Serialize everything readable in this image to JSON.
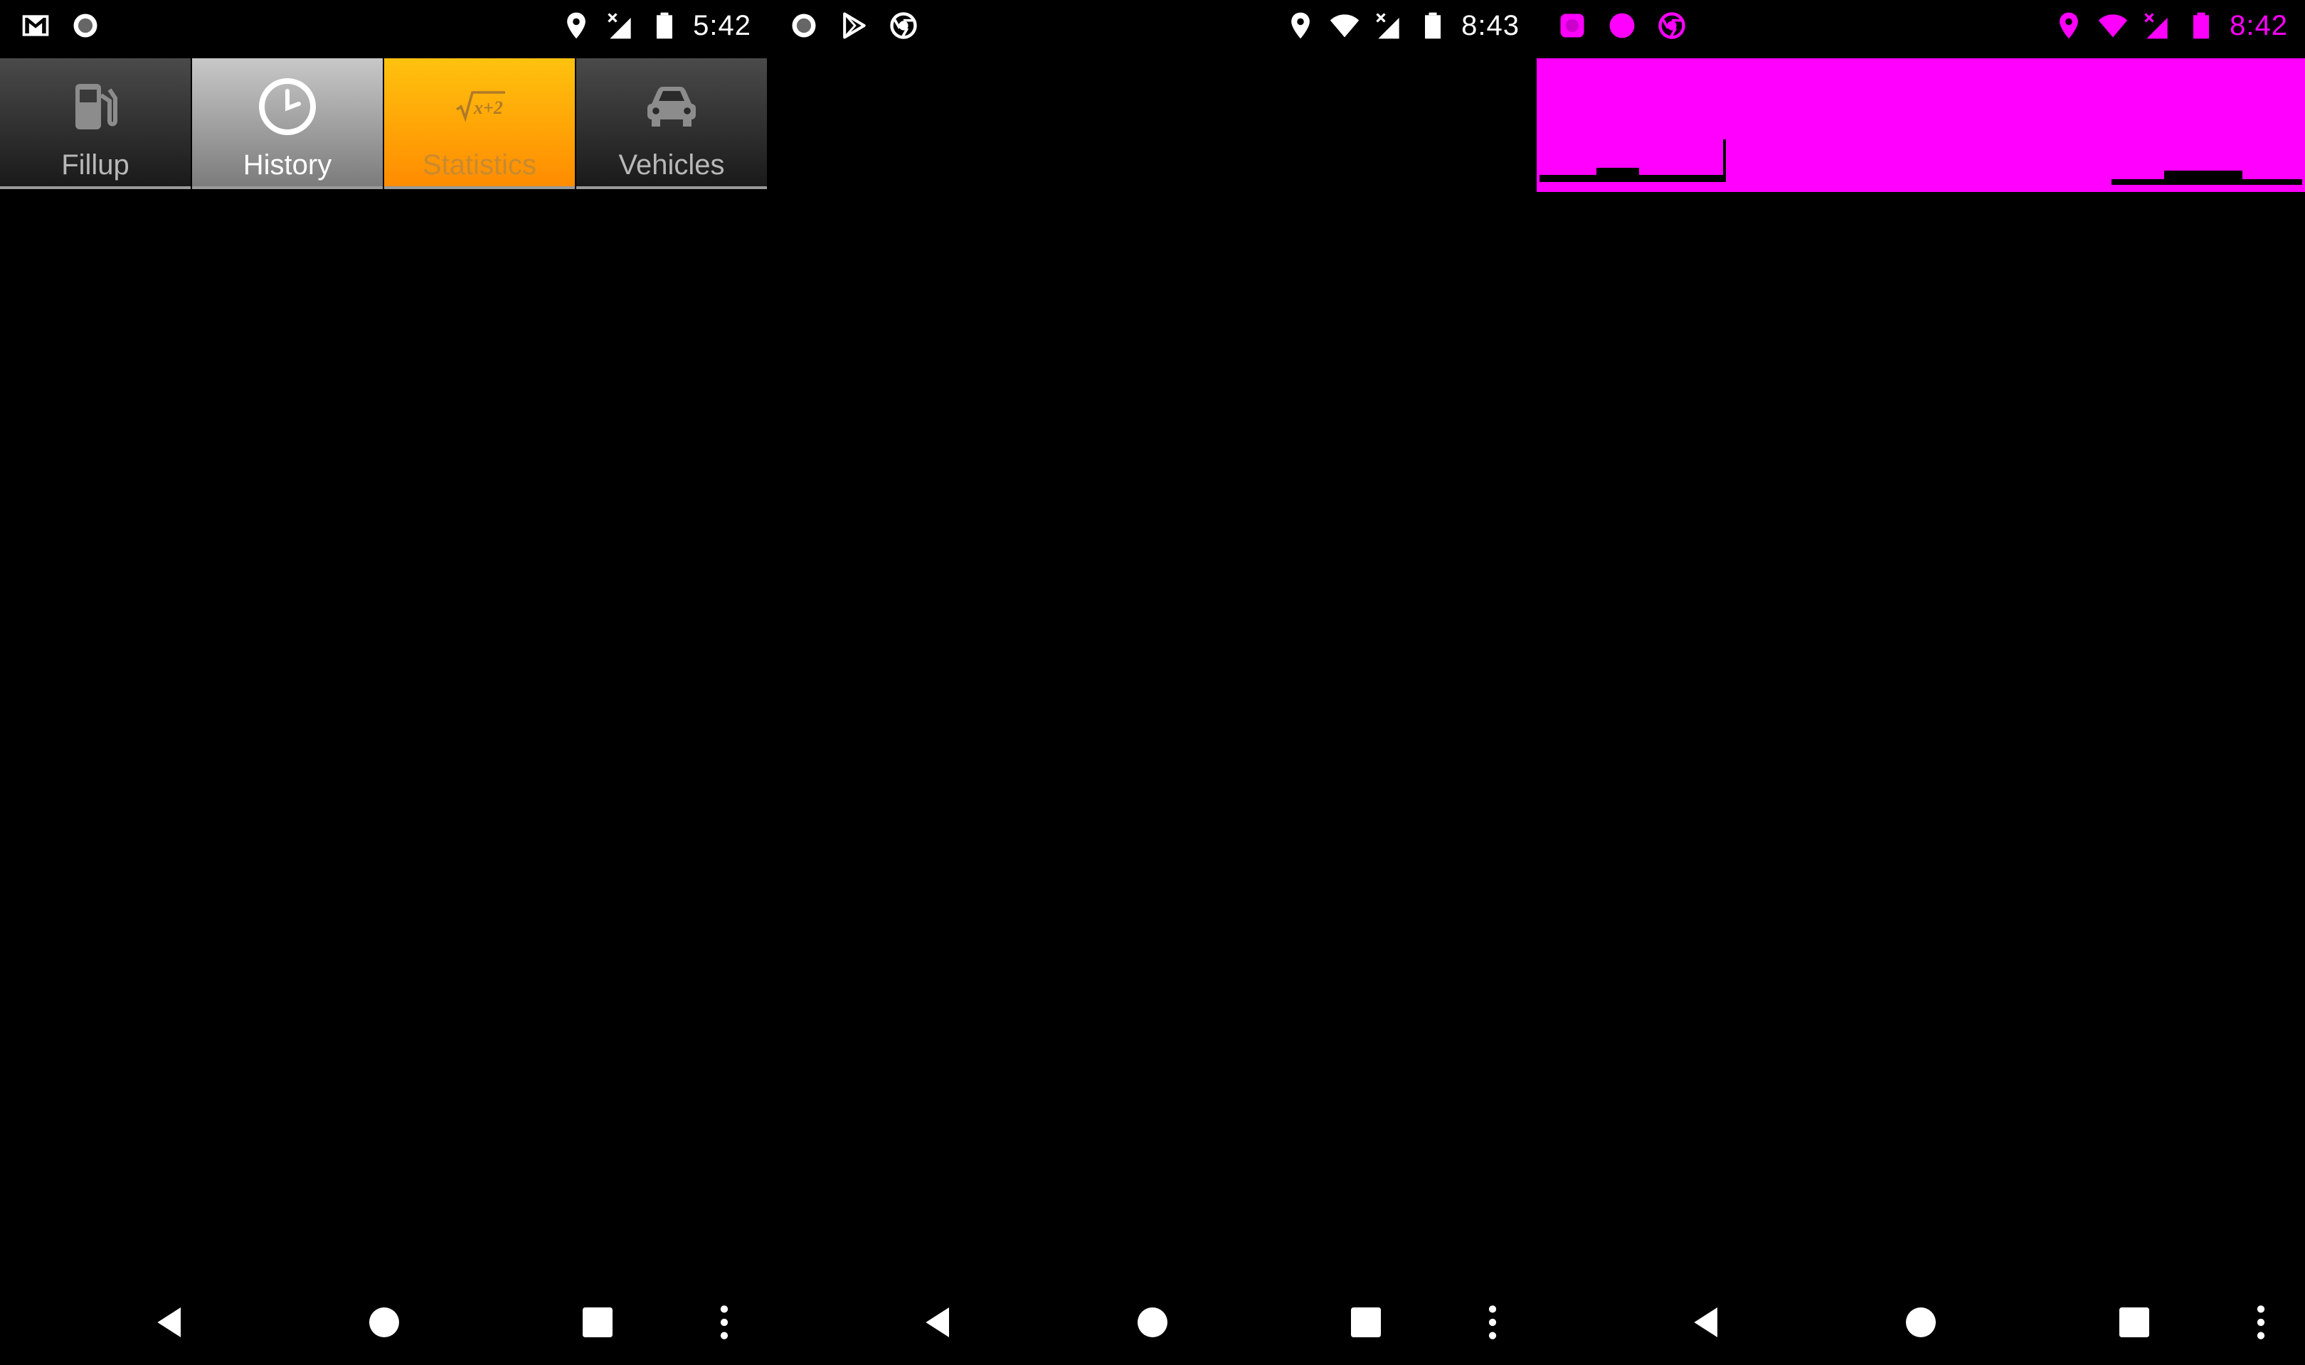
{
  "screens": [
    {
      "status_bar": {
        "time": "5:42",
        "left_icons": [
          "gmail-icon",
          "record-icon"
        ],
        "right_icons": [
          "location-icon",
          "signal-no-data-icon",
          "battery-icon"
        ]
      },
      "tabs": [
        {
          "label": "Fillup",
          "icon": "fuel-pump-icon",
          "state": "normal"
        },
        {
          "label": "History",
          "icon": "clock-icon",
          "state": "selected"
        },
        {
          "label": "Statistics",
          "icon": "math-formula-icon",
          "state": "focused"
        },
        {
          "label": "Vehicles",
          "icon": "car-icon",
          "state": "normal"
        }
      ],
      "nav": [
        "back-icon",
        "home-icon",
        "recents-icon",
        "more-vert-icon"
      ]
    },
    {
      "status_bar": {
        "time": "8:43",
        "left_icons": [
          "record-icon",
          "play-store-icon",
          "chrome-icon"
        ],
        "right_icons": [
          "location-icon",
          "wifi-icon",
          "signal-no-data-icon",
          "battery-icon"
        ]
      },
      "nav": [
        "back-icon",
        "home-icon",
        "recents-icon",
        "more-vert-icon"
      ]
    },
    {
      "status_bar": {
        "time": "8:42",
        "left_icons": [
          "record-icon",
          "record-icon",
          "chrome-icon"
        ],
        "right_icons": [
          "location-icon",
          "wifi-icon",
          "signal-no-data-icon",
          "battery-icon"
        ]
      },
      "nav": [
        "back-icon",
        "home-icon",
        "recents-icon",
        "more-vert-icon"
      ]
    }
  ],
  "colors": {
    "background": "#000000",
    "status_icon": "#ffffff",
    "overlay": "#ff00ff",
    "tab_focused": "#ffb300",
    "tab_selected": "#a0a0a0",
    "tab_normal": "#333333"
  }
}
